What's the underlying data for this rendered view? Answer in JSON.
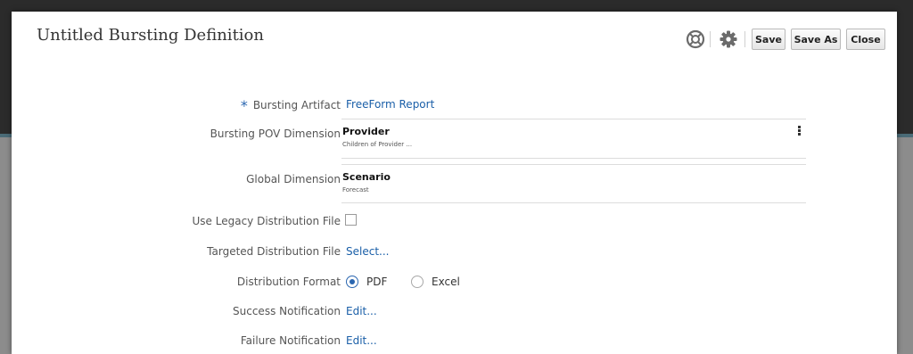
{
  "dialog": {
    "title": "Untitled Bursting Definition"
  },
  "toolbar": {
    "help_icon": "lifebuoy-icon",
    "settings_icon": "gear-icon",
    "save_label": "Save",
    "save_as_label": "Save As",
    "close_label": "Close"
  },
  "form": {
    "required_marker": "*",
    "bursting_artifact": {
      "label": "Bursting Artifact",
      "value": "FreeForm Report"
    },
    "pov_dimension": {
      "label": "Bursting POV Dimension",
      "name": "Provider",
      "detail": "Children of Provider ..."
    },
    "global_dimension": {
      "label": "Global Dimension",
      "name": "Scenario",
      "detail": "Forecast"
    },
    "legacy_distribution": {
      "label": "Use Legacy Distribution File",
      "checked": false
    },
    "targeted_distribution": {
      "label": "Targeted Distribution File",
      "value": "Select..."
    },
    "distribution_format": {
      "label": "Distribution Format",
      "options": [
        "PDF",
        "Excel"
      ],
      "selected": "PDF"
    },
    "success_notification": {
      "label": "Success Notification",
      "value": "Edit..."
    },
    "failure_notification": {
      "label": "Failure Notification",
      "value": "Edit..."
    }
  },
  "colors": {
    "link": "#1a5fa8",
    "accent": "#2a66b0",
    "backdrop": "#2b2b2b"
  }
}
